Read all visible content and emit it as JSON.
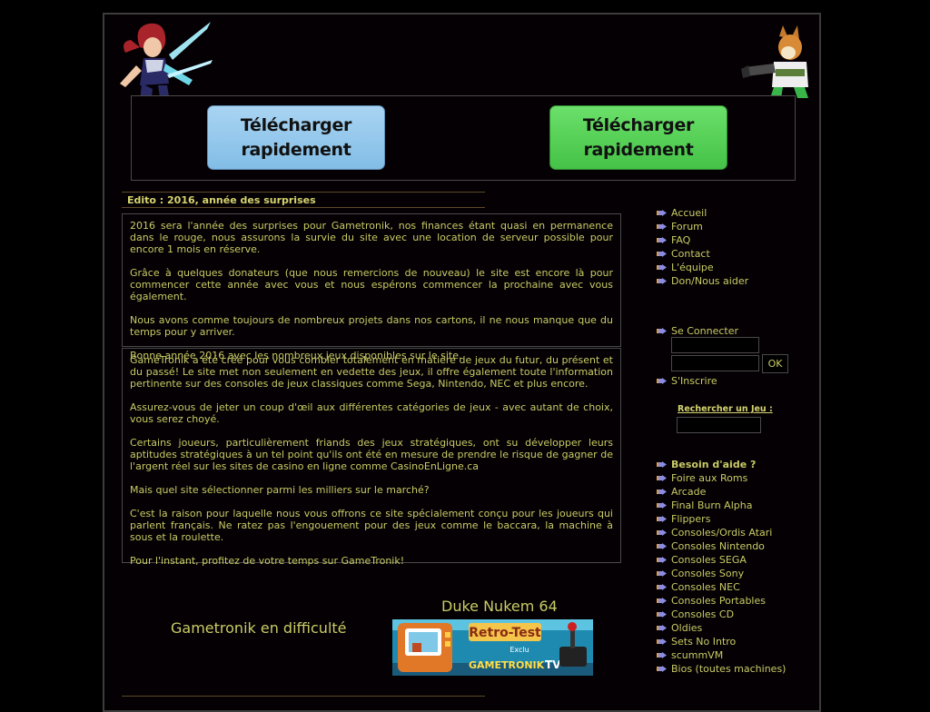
{
  "banner": {
    "download_left": "Télécharger rapidement",
    "download_right": "Télécharger rapidement"
  },
  "edito": {
    "title": "Edito : 2016, année des surprises",
    "paragraphs": [
      "2016 sera l'année des surprises pour Gametronik, nos finances étant quasi en permanence dans le rouge, nous assurons la survie du site avec une location de serveur possible pour encore 1 mois en réserve.",
      "Grâce à quelques donateurs (que nous remercions de nouveau) le site est encore là pour commencer cette année avec vous et nous espérons commencer la prochaine avec vous également.",
      "Nous avons comme toujours de nombreux projets dans nos cartons, il ne nous manque que du temps pour y arriver.",
      "Bonne année 2016 avec les nombreux jeux disponibles sur le site."
    ]
  },
  "about": {
    "paragraphs": [
      "GameTronik a été créé pour vous combler totalement en matière de jeux du futur, du présent et du passé! Le site met non seulement en vedette des jeux, il offre également toute l'information pertinente sur des consoles de jeux classiques comme Sega, Nintendo, NEC et plus encore.",
      "Assurez-vous de jeter un coup d'œil aux différentes catégories de jeux - avec autant de choix, vous serez choyé.",
      "Certains joueurs, particulièrement friands des jeux stratégiques, ont su développer leurs aptitudes stratégiques à un tel point qu'ils ont été en mesure de prendre le risque de gagner de l'argent réel sur les sites de casino en ligne comme CasinoEnLigne.ca",
      "Mais quel site sélectionner parmi les milliers sur le marché?",
      "C'est la raison pour laquelle nous vous offrons ce site spécialement conçu pour les joueurs qui parlent français. Ne ratez pas l'engouement pour des jeux comme le baccara, la machine à sous et la roulette.",
      "Pour l'instant, profitez de votre temps sur GameTronik!"
    ]
  },
  "news": {
    "left_title": "Gametronik en difficulté",
    "right_title": "Duke Nukem 64",
    "image_text": {
      "retro": "Retro-Test",
      "exclu": "Exclu",
      "brand": "GAMETRONIK",
      "tv": "TV"
    }
  },
  "nav_main": [
    "Accueil",
    "Forum",
    "FAQ",
    "Contact",
    "L'équipe",
    "Don/Nous aider"
  ],
  "login": {
    "connect": "Se Connecter",
    "ok": "OK",
    "signup": "S'Inscrire"
  },
  "search": {
    "label": "Rechercher un Jeu :"
  },
  "nav_categories": [
    "Besoin d'aide ?",
    "Foire aux Roms",
    "Arcade",
    "Final Burn Alpha",
    "Flippers",
    "Consoles/Ordis Atari",
    "Consoles Nintendo",
    "Consoles SEGA",
    "Consoles Sony",
    "Consoles NEC",
    "Consoles Portables",
    "Consoles CD",
    "Oldies",
    "Sets No Intro",
    "scummVM",
    "Bios (toutes machines)"
  ],
  "colors": {
    "background": "#000000",
    "text": "#c8cc66",
    "download_left": "#93c9ee",
    "download_right": "#55d155"
  }
}
